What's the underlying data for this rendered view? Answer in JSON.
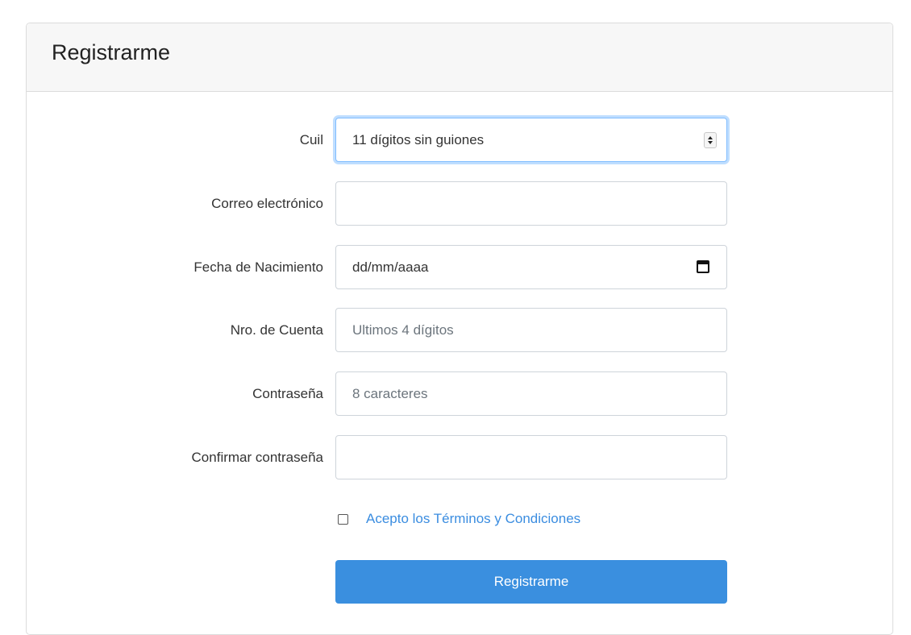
{
  "card": {
    "title": "Registrarme"
  },
  "fields": {
    "cuil": {
      "label": "Cuil",
      "value": "11 dígitos sin guiones"
    },
    "email": {
      "label": "Correo electrónico",
      "value": ""
    },
    "birthdate": {
      "label": "Fecha de Nacimiento",
      "value": "dd/mm/aaaa"
    },
    "account": {
      "label": "Nro. de Cuenta",
      "placeholder": "Ultimos 4 dígitos"
    },
    "password": {
      "label": "Contraseña",
      "placeholder": "8 caracteres"
    },
    "confirm_password": {
      "label": "Confirmar contraseña",
      "placeholder": ""
    }
  },
  "terms": {
    "label": "Acepto los Términos y Condiciones",
    "checked": false
  },
  "submit": {
    "label": "Registrarme"
  },
  "colors": {
    "primary": "#3a8fdf",
    "link": "#3b8de0",
    "focus": "#80bdff"
  },
  "icons": {
    "cuil": "spinner-arrows-icon",
    "birthdate": "calendar-icon"
  }
}
